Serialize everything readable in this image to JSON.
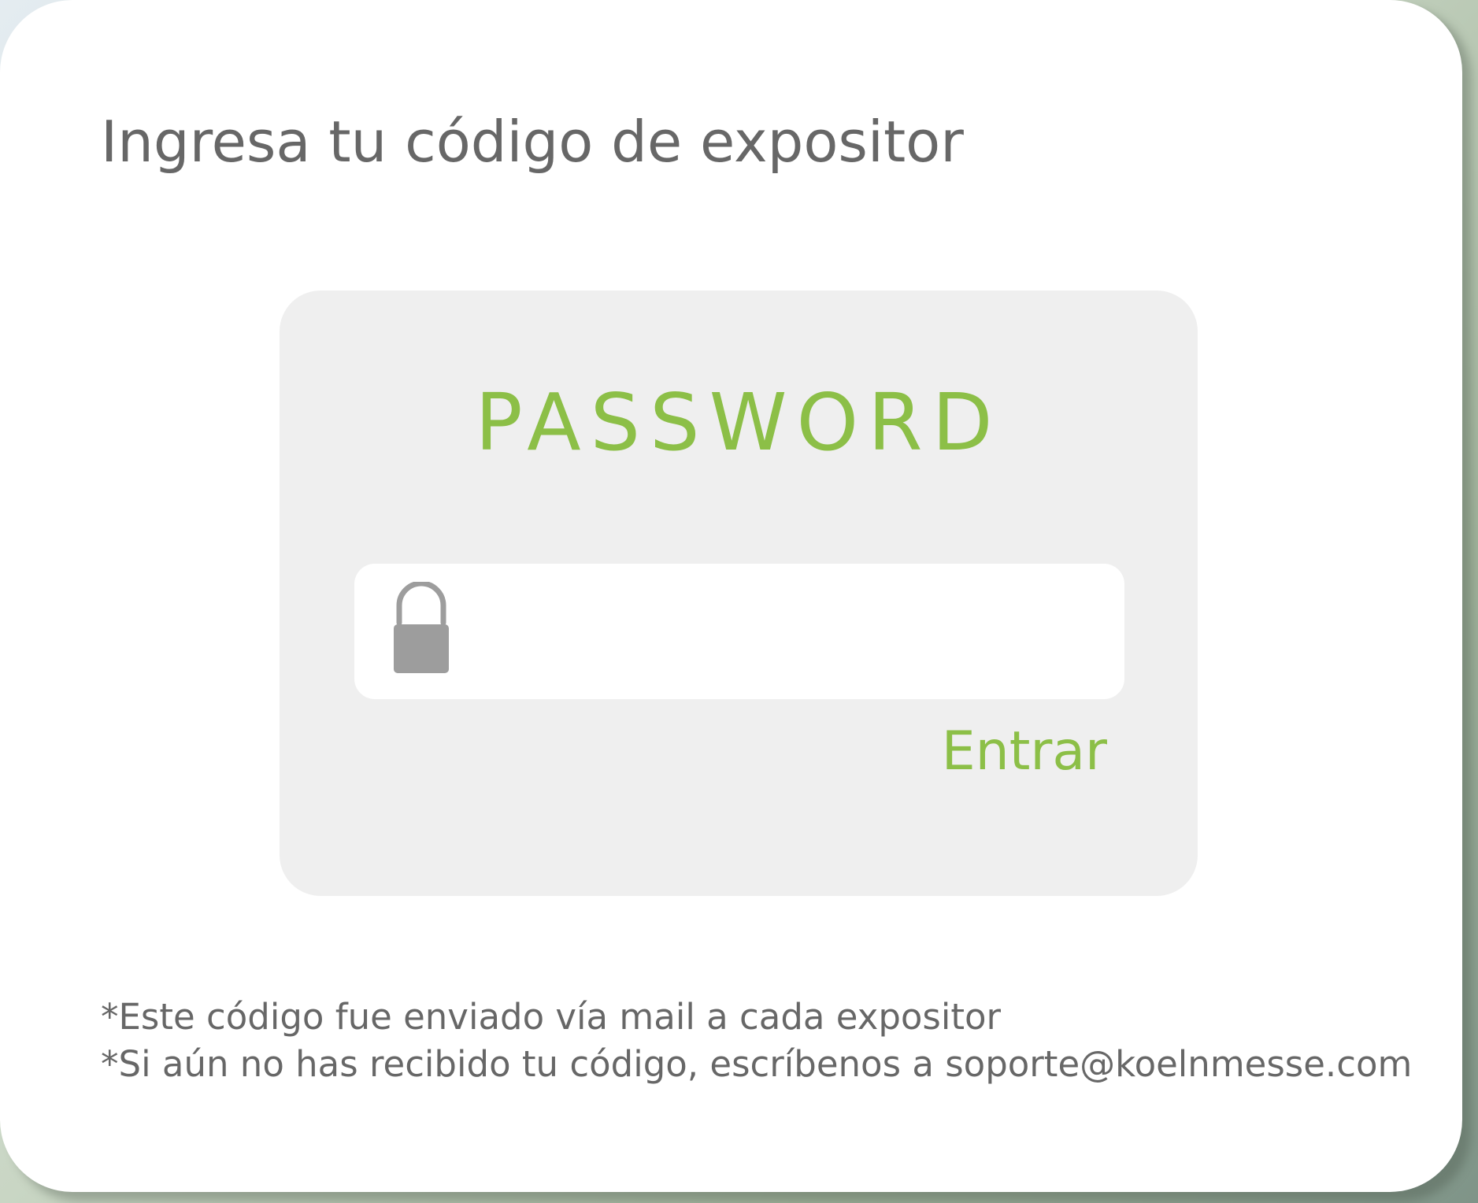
{
  "page": {
    "title": "Ingresa tu código de expositor"
  },
  "login": {
    "heading": "PASSWORD",
    "password_value": "",
    "submit_label": "Entrar"
  },
  "footer": {
    "notes": [
      "*Este código fue enviado vía mail a cada expositor",
      "*Si aún no has recibido tu código, escríbenos a soporte@koelnmesse.com"
    ]
  },
  "icons": {
    "password_field": "lock-icon"
  },
  "colors": {
    "accent": "#8cbf47",
    "text": "#676767",
    "panel_background": "#efefef",
    "card_background": "#ffffff",
    "icon": "#9d9d9d"
  }
}
